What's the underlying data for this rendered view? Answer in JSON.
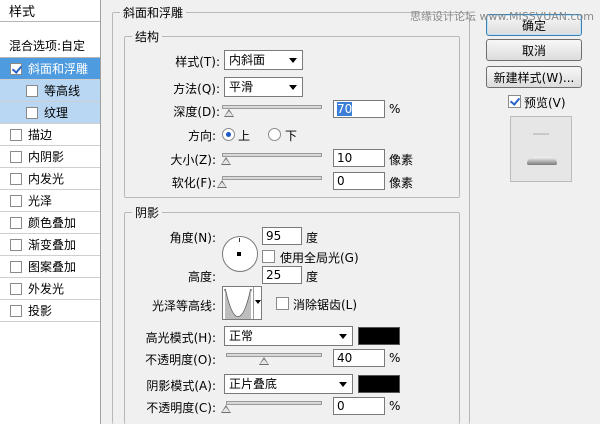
{
  "left_panel": {
    "title": "样式",
    "blend_options": "混合选项:自定",
    "items": [
      {
        "label": "斜面和浮雕",
        "checked": true,
        "selected": true
      },
      {
        "label": "等高线",
        "checked": false,
        "sub": true
      },
      {
        "label": "纹理",
        "checked": false,
        "sub": true
      },
      {
        "label": "描边",
        "checked": false
      },
      {
        "label": "内阴影",
        "checked": false
      },
      {
        "label": "内发光",
        "checked": false
      },
      {
        "label": "光泽",
        "checked": false
      },
      {
        "label": "颜色叠加",
        "checked": false
      },
      {
        "label": "渐变叠加",
        "checked": false
      },
      {
        "label": "图案叠加",
        "checked": false
      },
      {
        "label": "外发光",
        "checked": false
      },
      {
        "label": "投影",
        "checked": false
      }
    ]
  },
  "bevel": {
    "section_title": "斜面和浮雕",
    "structure": {
      "title": "结构",
      "style_label": "样式(T):",
      "style_value": "内斜面",
      "technique_label": "方法(Q):",
      "technique_value": "平滑",
      "depth_label": "深度(D):",
      "depth_value": "70",
      "depth_unit": "%",
      "depth_slider": 0.07,
      "direction_label": "方向:",
      "direction_up": "上",
      "direction_down": "下",
      "size_label": "大小(Z):",
      "size_value": "10",
      "size_unit": "像素",
      "size_slider": 0.04,
      "soften_label": "软化(F):",
      "soften_value": "0",
      "soften_unit": "像素",
      "soften_slider": 0.0
    },
    "shading": {
      "title": "阴影",
      "angle_label": "角度(N):",
      "angle_value": "95",
      "angle_unit": "度",
      "global_light_label": "使用全局光(G)",
      "altitude_label": "高度:",
      "altitude_value": "25",
      "altitude_unit": "度",
      "gloss_contour_label": "光泽等高线:",
      "anti_alias_label": "消除锯齿(L)",
      "highlight_mode_label": "高光模式(H):",
      "highlight_mode_value": "正常",
      "highlight_color": "#000000",
      "highlight_opacity_label": "不透明度(O):",
      "highlight_opacity_value": "40",
      "highlight_opacity_unit": "%",
      "highlight_opacity_slider": 0.4,
      "shadow_mode_label": "阴影模式(A):",
      "shadow_mode_value": "正片叠底",
      "shadow_color": "#000000",
      "shadow_opacity_label": "不透明度(C):",
      "shadow_opacity_value": "0",
      "shadow_opacity_unit": "%",
      "shadow_opacity_slider": 0.0
    }
  },
  "right_panel": {
    "ok_label": "确定",
    "cancel_label": "取消",
    "new_style_label": "新建样式(W)...",
    "preview_label": "预览(V)"
  },
  "watermark": "思缘设计论坛 www.MISSVUAN.com",
  "colors": {
    "selected_row": "#4f9bdf",
    "sub_row": "#b9d6f2",
    "highlight_field": "#3b7fd6"
  }
}
